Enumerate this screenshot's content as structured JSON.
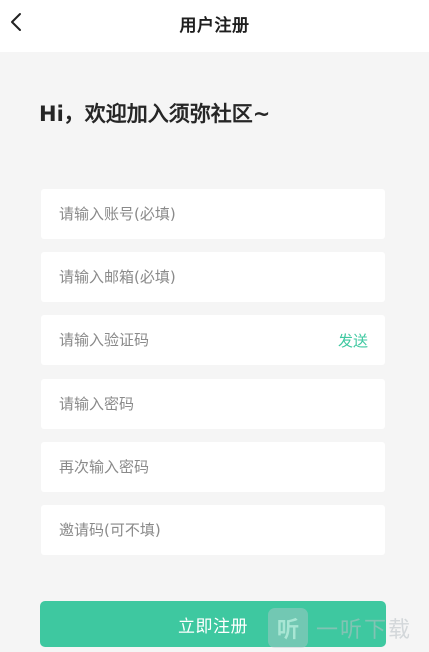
{
  "header": {
    "title": "用户注册",
    "back_icon": "chevron-left-icon"
  },
  "welcome": "Hi，欢迎加入须弥社区~",
  "form": {
    "account": {
      "placeholder": "请输入账号(必填)",
      "value": ""
    },
    "email": {
      "placeholder": "请输入邮箱(必填)",
      "value": ""
    },
    "verify_code": {
      "placeholder": "请输入验证码",
      "value": "",
      "action_label": "发送"
    },
    "password": {
      "placeholder": "请输入密码",
      "value": ""
    },
    "confirm_password": {
      "placeholder": "再次输入密码",
      "value": ""
    },
    "invite_code": {
      "placeholder": "邀请码(可不填)",
      "value": ""
    }
  },
  "submit_label": "立即注册",
  "watermark": {
    "logo_char": "听",
    "text": "一听下载"
  },
  "colors": {
    "accent": "#3ec8a0",
    "background": "#f5f5f5",
    "field_background": "#ffffff",
    "title_text": "#1f1f1f",
    "placeholder_text": "#8a8a8a"
  }
}
